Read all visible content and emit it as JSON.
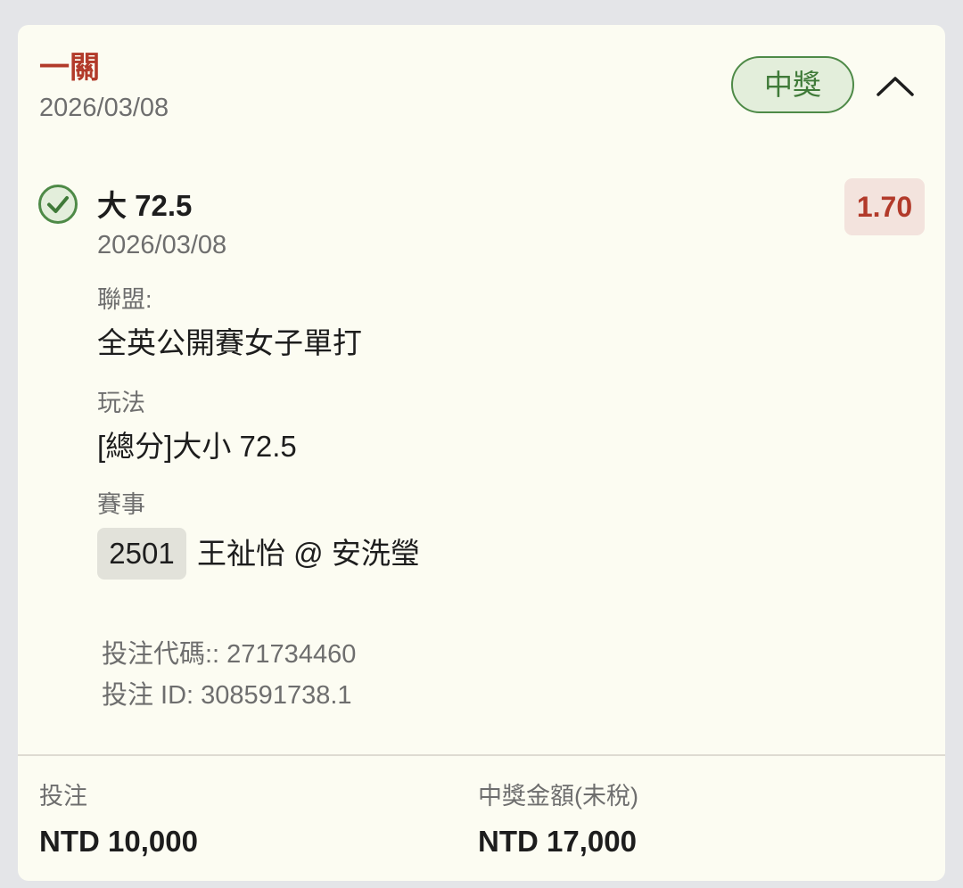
{
  "header": {
    "bet_type": "一關",
    "date": "2026/03/08",
    "status": "中獎"
  },
  "selection": {
    "name": "大 72.5",
    "date": "2026/03/08",
    "odds": "1.70",
    "league_label": "聯盟:",
    "league": "全英公開賽女子單打",
    "market_label": "玩法",
    "market": "[總分]大小 72.5",
    "event_label": "賽事",
    "event_code": "2501",
    "event_name": "王祉怡 @ 安洗瑩"
  },
  "meta": {
    "bet_code": "投注代碼:: 271734460",
    "bet_id": "投注 ID: 308591738.1"
  },
  "footer": {
    "stake_label": "投注",
    "stake_value": "NTD 10,000",
    "payout_label": "中獎金額(未稅)",
    "payout_value": "NTD 17,000"
  },
  "icons": {
    "check": "check-circle-icon",
    "collapse": "chevron-up-icon"
  },
  "colors": {
    "accent_red": "#b23a2a",
    "win_green": "#4e8a47",
    "card_bg": "#fcfcf2"
  }
}
